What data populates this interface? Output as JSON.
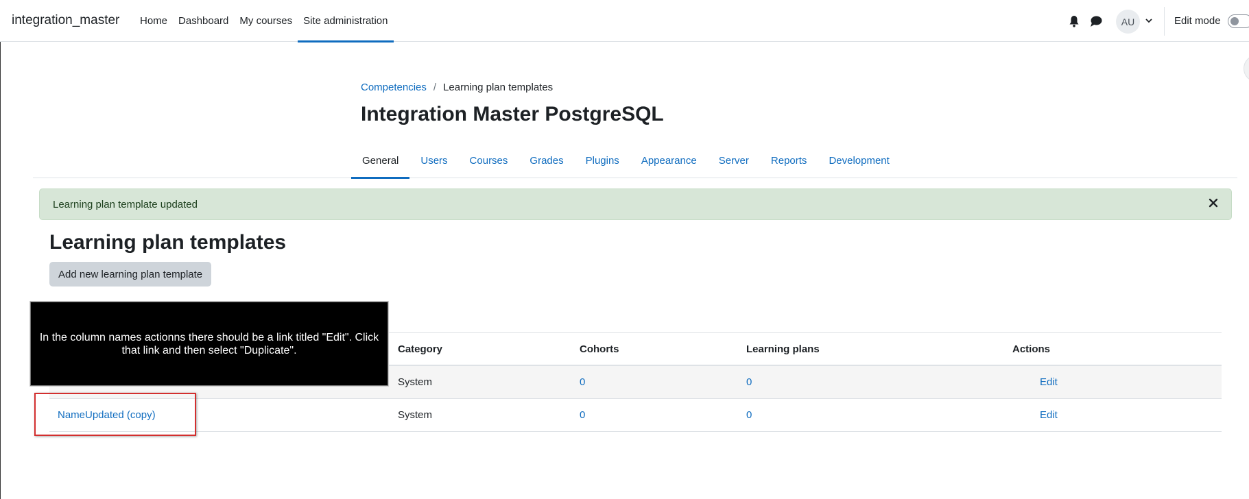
{
  "navbar": {
    "brand": "integration_master",
    "items": [
      {
        "label": "Home",
        "active": false
      },
      {
        "label": "Dashboard",
        "active": false
      },
      {
        "label": "My courses",
        "active": false
      },
      {
        "label": "Site administration",
        "active": true
      }
    ],
    "avatar_initials": "AU",
    "edit_mode_label": "Edit mode",
    "edit_mode_on": false,
    "icons": [
      "bell-icon",
      "chat-icon",
      "chevron-down-icon"
    ]
  },
  "breadcrumb": {
    "parent": "Competencies",
    "separator": "/",
    "current": "Learning plan templates"
  },
  "page_title": "Integration Master PostgreSQL",
  "secondary_nav": {
    "tabs": [
      {
        "label": "General",
        "active": true
      },
      {
        "label": "Users",
        "active": false
      },
      {
        "label": "Courses",
        "active": false
      },
      {
        "label": "Grades",
        "active": false
      },
      {
        "label": "Plugins",
        "active": false
      },
      {
        "label": "Appearance",
        "active": false
      },
      {
        "label": "Server",
        "active": false
      },
      {
        "label": "Reports",
        "active": false
      },
      {
        "label": "Development",
        "active": false
      }
    ]
  },
  "alert": {
    "message": "Learning plan template updated",
    "close_icon": "close-icon"
  },
  "section": {
    "heading": "Learning plan templates",
    "add_button": "Add new learning plan template"
  },
  "table": {
    "headers": {
      "category": "Category",
      "cohorts": "Cohorts",
      "learning_plans": "Learning plans",
      "actions": "Actions"
    },
    "rows": [
      {
        "name": "",
        "category": "System",
        "cohorts": "0",
        "learning_plans": "0",
        "action": "Edit"
      },
      {
        "name": "NameUpdated (copy)",
        "category": "System",
        "cohorts": "0",
        "learning_plans": "0",
        "action": "Edit"
      }
    ]
  },
  "tooltip": {
    "text": "In the column names actionns there should be a link titled \"Edit\". Click that link and then select \"Duplicate\"."
  },
  "colors": {
    "link": "#0f6cbf",
    "alert_bg": "#d7e6d7",
    "highlight": "#d32f2f",
    "tooltip_bg": "#000000"
  }
}
